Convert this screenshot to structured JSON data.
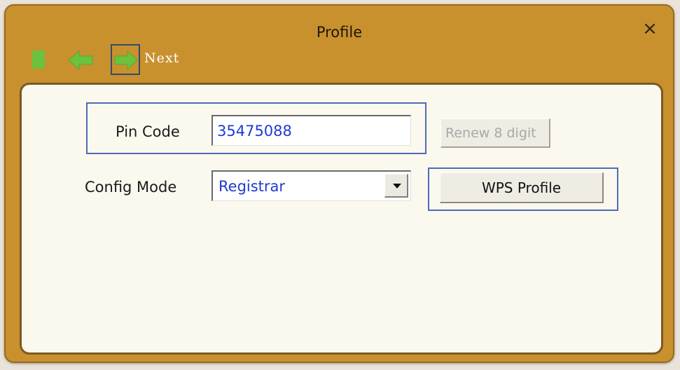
{
  "window": {
    "title": "Profile",
    "close_glyph": "×"
  },
  "toolbar": {
    "stop_icon": "stop-icon",
    "back_icon": "back-arrow-icon",
    "next_icon": "next-arrow-icon",
    "next_label": "Next"
  },
  "form": {
    "pin_label": "Pin Code",
    "pin_value": "35475088",
    "renew_label": "Renew 8 digit",
    "config_label": "Config Mode",
    "config_value": "Registrar",
    "wps_label": "WPS Profile"
  },
  "colors": {
    "frame": "#c8912e",
    "panel": "#fbf8ee",
    "group_border": "#4d6cb8",
    "value_text": "#1f3bd0",
    "nav_green": "#6bc23d"
  }
}
